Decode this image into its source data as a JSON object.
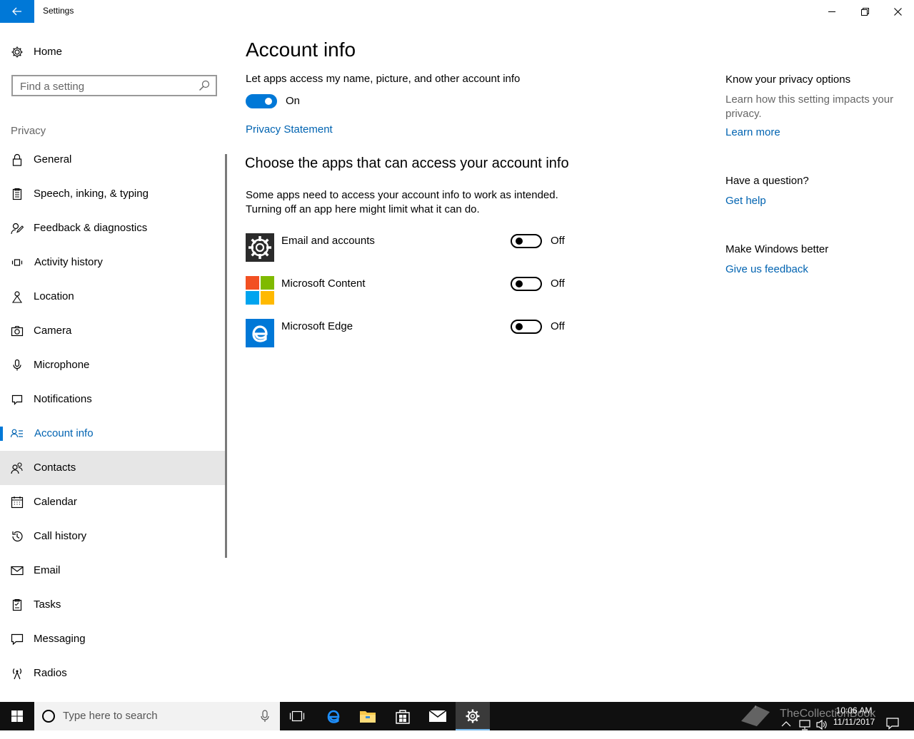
{
  "window": {
    "title": "Settings",
    "back_icon": "arrow-left-icon",
    "controls": [
      "minimize-icon",
      "restore-icon",
      "close-icon"
    ]
  },
  "sidebar": {
    "home_label": "Home",
    "home_icon": "gear-icon",
    "search_placeholder": "Find a setting",
    "section_header": "Privacy",
    "items": [
      {
        "label": "General",
        "icon": "lock-icon"
      },
      {
        "label": "Speech, inking, & typing",
        "icon": "clipboard-icon"
      },
      {
        "label": "Feedback & diagnostics",
        "icon": "person-feedback-icon"
      },
      {
        "label": "Activity history",
        "icon": "activity-icon"
      },
      {
        "label": "Location",
        "icon": "location-icon"
      },
      {
        "label": "Camera",
        "icon": "camera-icon"
      },
      {
        "label": "Microphone",
        "icon": "microphone-icon"
      },
      {
        "label": "Notifications",
        "icon": "notifications-icon"
      },
      {
        "label": "Account info",
        "icon": "account-info-icon",
        "active": true
      },
      {
        "label": "Contacts",
        "icon": "contacts-icon",
        "hover": true
      },
      {
        "label": "Calendar",
        "icon": "calendar-icon"
      },
      {
        "label": "Call history",
        "icon": "history-icon"
      },
      {
        "label": "Email",
        "icon": "mail-icon"
      },
      {
        "label": "Tasks",
        "icon": "tasks-icon"
      },
      {
        "label": "Messaging",
        "icon": "message-icon"
      },
      {
        "label": "Radios",
        "icon": "radio-tower-icon"
      }
    ]
  },
  "main": {
    "title": "Account info",
    "let_apps_access": "Let apps access my name, picture, and other account info",
    "master_toggle": {
      "state": "On",
      "on": true
    },
    "privacy_link": "Privacy Statement",
    "choose_title": "Choose the apps that can access your account info",
    "paragraph_line1": "Some apps need to access your account info to work as intended.",
    "paragraph_line2": "Turning off an app here might limit what it can do.",
    "apps": [
      {
        "name": "Email and accounts",
        "state": "Off",
        "icon": "settings-gear-app-icon"
      },
      {
        "name": "Microsoft Content",
        "state": "Off",
        "icon": "microsoft-logo-icon"
      },
      {
        "name": "Microsoft Edge",
        "state": "Off",
        "icon": "edge-icon"
      }
    ]
  },
  "right_panel": {
    "privacy_header": "Know your privacy options",
    "privacy_text": "Learn how this setting impacts your privacy.",
    "learn_more": "Learn more",
    "question_header": "Have a question?",
    "get_help": "Get help",
    "better_header": "Make Windows better",
    "feedback": "Give us feedback"
  },
  "taskbar": {
    "search_placeholder": "Type here to search",
    "time": "10:06 AM",
    "date": "11/11/2017",
    "watermark": "TheCollectionBook"
  },
  "colors": {
    "accent": "#0078d7",
    "link": "#0063b1",
    "taskbar": "#101010"
  }
}
